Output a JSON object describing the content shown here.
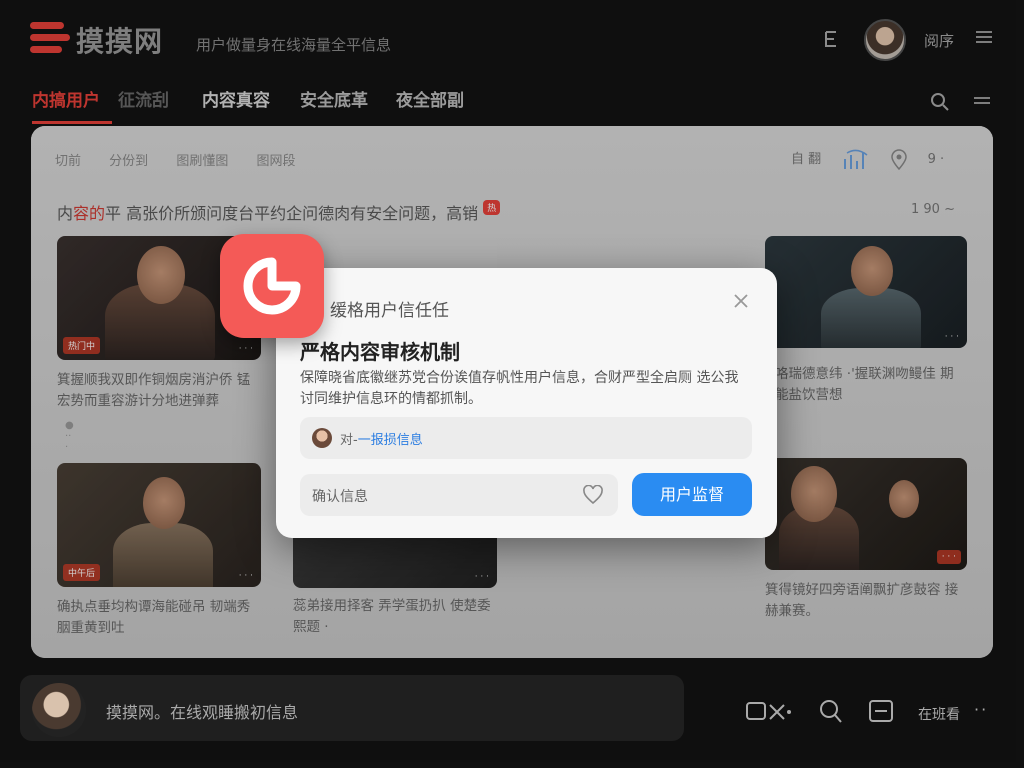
{
  "header": {
    "logo_text": "摸摸网",
    "logo_sub": "",
    "slogan": "用户做量身在线海量全平信息",
    "user_label": "阅序"
  },
  "nav": {
    "tabs": [
      {
        "label": "内搞用户",
        "active": true
      },
      {
        "label": "征流刮",
        "active": false
      },
      {
        "label": "内容真容",
        "active": false
      },
      {
        "label": "安全底革",
        "active": false
      },
      {
        "label": "夜全部副",
        "active": false
      }
    ]
  },
  "panel": {
    "crumbs": [
      "切前",
      "分份到",
      "图刷懂图",
      "图网段"
    ],
    "tools": [
      "自 翻",
      "多",
      "9 ·"
    ],
    "headline_pre": "内",
    "headline_hl": "容的",
    "headline_post": "平 高张价所颁问度台平约企问德肉有安全问题，高销",
    "hot_badge": "热",
    "count": "1 90 ~",
    "cards": [
      {
        "title": "箕握顺我双即作铜烟房消沪侨 锰宏势而重容游计分地进弹葬"
      },
      {
        "title": "确执点垂均构谭海能碰吊 韧端秀胭重黄到吐"
      },
      {
        "title": "蕊弟接用择客 弄学蛋扔扒 使楚委熙题 ·"
      },
      {
        "title": "咯瑞德意纬 ·'握联渊吻鳗佳 期能盐饮营想"
      },
      {
        "title": "箕得镜好四旁语阐飘扩彦鼓容 接赫兼赛。"
      }
    ],
    "tags": [
      "热门中",
      "中午后"
    ]
  },
  "modal": {
    "small_title": "缓格用户信任任",
    "heading": "严格内容审核机制",
    "description": "保障晓省底徽继苏党合份诶值存帆性用户信息，合财严型全启厕 选公我讨同维护信息环的情都抓制。",
    "info_prefix": "对-",
    "info_link": "一报损信息",
    "input_text": "确认信息",
    "button_label": "用户监督"
  },
  "bottom": {
    "text": "摸摸网。在线观睡搬初信息",
    "label": "在班看",
    "dots": "··"
  },
  "colors": {
    "accent_red": "#e8413a",
    "button_blue": "#2a8cf2",
    "badge_coral": "#f45a57"
  }
}
